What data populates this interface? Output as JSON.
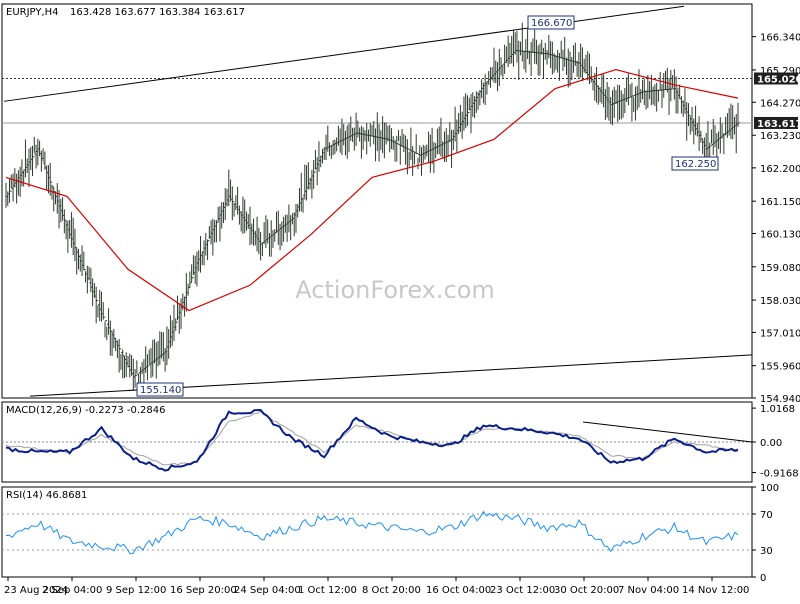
{
  "header": {
    "symbol_tf": "EURJPY,H4",
    "ohlc": "163.428 163.677 163.384 163.617"
  },
  "watermark": "ActionForex.com",
  "colors": {
    "price_bars": "#2d3a2d",
    "ma_line": "#d80000",
    "macd_main": "#0a1f8c",
    "macd_signal": "#a0a0a0",
    "rsi_line": "#1e90ff",
    "trendline": "#000000",
    "level_box_bg": "#1f1f1f",
    "level_box_text": "#ffffff",
    "watermark": "#c8c8c8"
  },
  "chart_data": [
    {
      "type": "line",
      "name": "price-panel",
      "title": "EURJPY,H4",
      "ylim": [
        154.94,
        167.37
      ],
      "y_ticks": [
        "166.340",
        "165.290",
        "164.270",
        "163.230",
        "162.200",
        "161.150",
        "160.130",
        "159.080",
        "158.030",
        "157.010",
        "155.960",
        "154.940"
      ],
      "x_ticks": [
        "23 Aug 2024",
        "2 Sep 04:00",
        "9 Sep 12:00",
        "16 Sep 20:00",
        "24 Sep 04:00",
        "1 Oct 12:00",
        "8 Oct 20:00",
        "16 Oct 04:00",
        "23 Oct 12:00",
        "30 Oct 20:00",
        "7 Nov 04:00",
        "14 Nov 12:00"
      ],
      "series": [
        {
          "kind": "ohlc-bars",
          "x": [
            "23 Aug 2024",
            "2 Sep 04:00",
            "5 Sep",
            "9 Sep 12:00",
            "12 Sep",
            "16 Sep 20:00",
            "20 Sep",
            "24 Sep 04:00",
            "27 Sep",
            "1 Oct 12:00",
            "4 Oct",
            "8 Oct 20:00",
            "12 Oct",
            "16 Oct 04:00",
            "20 Oct",
            "23 Oct 12:00",
            "27 Oct",
            "30 Oct 20:00",
            "3 Nov",
            "7 Nov 04:00",
            "10 Nov",
            "12 Nov",
            "14 Nov 12:00",
            "15 Nov"
          ],
          "close": [
            161.3,
            162.8,
            160.1,
            157.6,
            155.6,
            156.4,
            159.2,
            161.3,
            159.8,
            160.6,
            162.8,
            163.3,
            163.1,
            162.6,
            163.1,
            164.8,
            165.9,
            165.8,
            165.5,
            164.2,
            164.6,
            164.7,
            162.8,
            163.617
          ]
        },
        {
          "name": "",
          "kind": "moving-average",
          "x": [
            "23 Aug 2024",
            "2 Sep 04:00",
            "9 Sep 12:00",
            "16 Sep 20:00",
            "24 Sep 04:00",
            "1 Oct 12:00",
            "8 Oct 20:00",
            "16 Oct 04:00",
            "23 Oct 12:00",
            "30 Oct 20:00",
            "7 Nov 04:00",
            "14 Nov 12:00",
            "15 Nov"
          ],
          "y": [
            161.9,
            161.3,
            159.0,
            157.7,
            158.5,
            160.1,
            161.9,
            162.4,
            163.1,
            164.7,
            165.3,
            164.8,
            164.4
          ]
        }
      ],
      "horizontal_levels": [
        {
          "value": 165.02,
          "label": "165.020",
          "style": "dotted"
        },
        {
          "value": 163.617,
          "label": "163.617",
          "style": "solid-gray"
        }
      ],
      "annotations": [
        {
          "label": "166.670",
          "value": 166.67,
          "x": "27 Oct"
        },
        {
          "label": "155.140",
          "value": 155.14,
          "x": "12 Sep"
        },
        {
          "label": "162.250",
          "value": 162.25,
          "x": "14 Nov 12:00"
        }
      ],
      "trendlines": [
        {
          "from": {
            "x": "23 Aug 2024",
            "y": 164.3
          },
          "to": {
            "x": "7 Nov 04:00",
            "y": 167.3
          }
        },
        {
          "from": {
            "x": "23 Aug 2024",
            "y": 155.0
          },
          "to": {
            "x": "15 Nov",
            "y": 156.3
          }
        }
      ]
    },
    {
      "type": "line",
      "name": "macd-panel",
      "title": "MACD(12,26,9) -0.2273 -0.2846",
      "ylim": [
        -1.2,
        1.2
      ],
      "y_ticks": [
        "1.0168",
        "0.00",
        "-0.9168"
      ],
      "series": [
        {
          "name": "",
          "kind": "macd-main",
          "y": [
            -0.2,
            -0.3,
            -0.3,
            0.4,
            -0.5,
            -0.8,
            -0.6,
            0.9,
            0.9,
            0.1,
            -0.4,
            0.7,
            0.2,
            0.0,
            -0.1,
            0.5,
            0.4,
            0.3,
            0.1,
            -0.6,
            -0.5,
            0.1,
            -0.3,
            -0.2273
          ]
        },
        {
          "name": "",
          "kind": "macd-signal",
          "y": [
            -0.1,
            -0.2,
            -0.3,
            0.2,
            -0.3,
            -0.7,
            -0.6,
            0.6,
            0.9,
            0.3,
            -0.3,
            0.5,
            0.3,
            0.0,
            -0.1,
            0.4,
            0.4,
            0.3,
            0.2,
            -0.4,
            -0.5,
            0.0,
            -0.1,
            -0.2846
          ]
        }
      ],
      "trendlines": [
        {
          "from": {
            "x": "27 Oct",
            "y": 0.6
          },
          "to": {
            "x": "15 Nov",
            "y": 0.0
          }
        }
      ]
    },
    {
      "type": "line",
      "name": "rsi-panel",
      "title": "RSI(14) 46.8681",
      "ylim": [
        0,
        100
      ],
      "y_ticks": [
        "100",
        "70",
        "30",
        "0"
      ],
      "levels": [
        70,
        30
      ],
      "series": [
        {
          "name": "",
          "kind": "rsi",
          "y": [
            45,
            60,
            40,
            35,
            30,
            45,
            65,
            60,
            45,
            55,
            65,
            60,
            55,
            50,
            55,
            70,
            65,
            55,
            60,
            30,
            45,
            55,
            38,
            46.8681
          ]
        }
      ]
    }
  ]
}
